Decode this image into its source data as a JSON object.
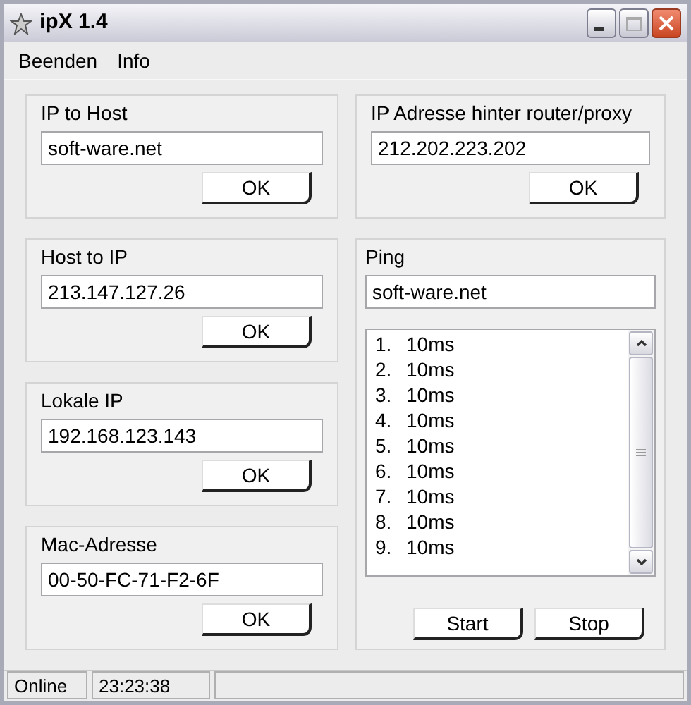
{
  "window": {
    "title": "ipX 1.4"
  },
  "menu": [
    {
      "label": "Beenden"
    },
    {
      "label": "Info"
    }
  ],
  "left_panels": [
    {
      "title": "IP to Host",
      "value": "soft-ware.net",
      "button": "OK"
    },
    {
      "title": "Host to IP",
      "value": "213.147.127.26",
      "button": "OK"
    },
    {
      "title": "Lokale IP",
      "value": "192.168.123.143",
      "button": "OK"
    },
    {
      "title": "Mac-Adresse",
      "value": "00-50-FC-71-F2-6F",
      "button": "OK"
    }
  ],
  "router_panel": {
    "title": "IP Adresse hinter router/proxy",
    "value": "212.202.223.202",
    "button": "OK"
  },
  "ping": {
    "title": "Ping",
    "host": "soft-ware.net",
    "results": [
      {
        "index": "1.",
        "time": "10ms"
      },
      {
        "index": "2.",
        "time": "10ms"
      },
      {
        "index": "3.",
        "time": "10ms"
      },
      {
        "index": "4.",
        "time": "10ms"
      },
      {
        "index": "5.",
        "time": "10ms"
      },
      {
        "index": "6.",
        "time": "10ms"
      },
      {
        "index": "7.",
        "time": "10ms"
      },
      {
        "index": "8.",
        "time": "10ms"
      },
      {
        "index": "9.",
        "time": "10ms"
      }
    ],
    "buttons": [
      "Start",
      "Stop"
    ]
  },
  "status_bar": [
    "Online",
    "23:23:38"
  ]
}
